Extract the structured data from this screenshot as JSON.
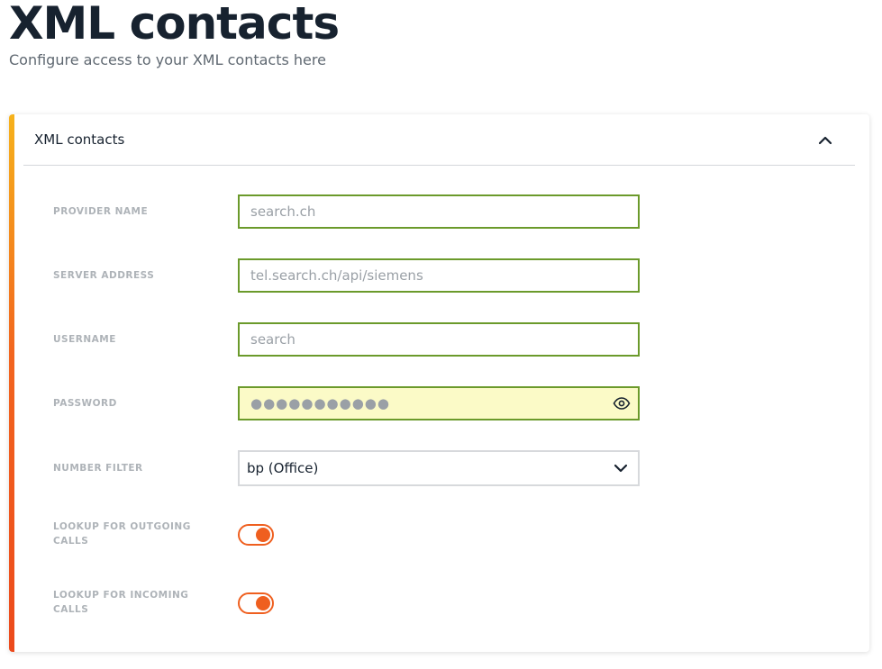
{
  "page": {
    "title": "XML contacts",
    "subtitle": "Configure access to your XML contacts here"
  },
  "card": {
    "title": "XML contacts",
    "accent_colors": [
      "#f6b21b",
      "#f2651f",
      "#ec4a1c"
    ]
  },
  "form": {
    "provider_name": {
      "label": "PROVIDER NAME",
      "value": "search.ch"
    },
    "server_address": {
      "label": "SERVER ADDRESS",
      "value": "tel.search.ch/api/siemens"
    },
    "username": {
      "label": "USERNAME",
      "value": "search"
    },
    "password": {
      "label": "PASSWORD",
      "value": "●●●●●●●●●●●"
    },
    "number_filter": {
      "label": "NUMBER FILTER",
      "selected": "bp (Office)"
    },
    "lookup_outgoing": {
      "label": "LOOKUP FOR OUTGOING CALLS",
      "enabled": true
    },
    "lookup_incoming": {
      "label": "LOOKUP FOR INCOMING CALLS",
      "enabled": true
    }
  },
  "icons": {
    "collapse": "chevron-up-icon",
    "show_password": "eye-icon",
    "dropdown": "chevron-down-icon"
  },
  "colors": {
    "input_border": "#6b9a2b",
    "autofill_background": "#fbfac7",
    "toggle_on": "#ef5f1f",
    "label": "#aeb3b8",
    "title": "#17222f"
  }
}
